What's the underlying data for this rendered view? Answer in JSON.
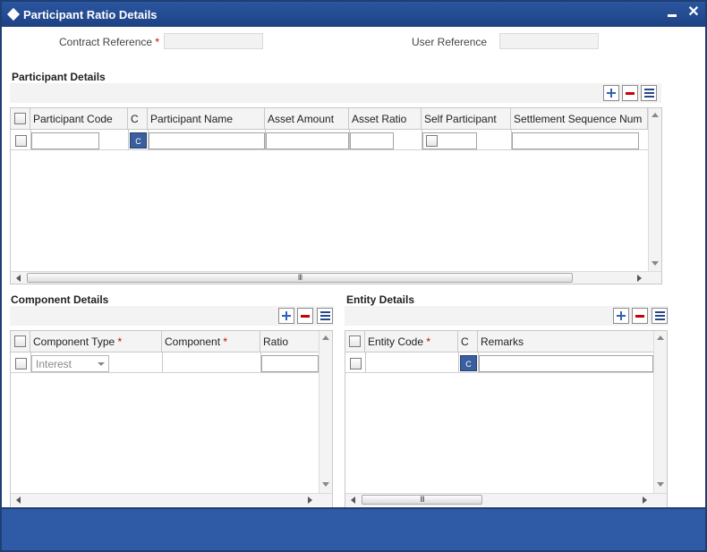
{
  "window": {
    "title": "Participant Ratio Details"
  },
  "header": {
    "contract_reference_label": "Contract Reference",
    "user_reference_label": "User Reference",
    "required_mark": "*",
    "contract_reference_value": "",
    "user_reference_value": ""
  },
  "participant": {
    "title": "Participant Details",
    "columns": [
      "Participant Code",
      "C",
      "Participant Name",
      "Asset Amount",
      "Asset Ratio",
      "Self Participant",
      "Settlement Sequence Num"
    ],
    "row_badge": "C"
  },
  "component": {
    "title": "Component Details",
    "columns": {
      "component_type": "Component Type",
      "component": "Component",
      "ratio": "Ratio"
    },
    "required_mark": "*",
    "row": {
      "component_type": "Interest"
    }
  },
  "entity": {
    "title": "Entity Details",
    "columns": {
      "entity_code": "Entity Code",
      "c": "C",
      "remarks": "Remarks"
    },
    "required_mark": "*",
    "row_badge": "C"
  },
  "icons": {
    "window": "diamond-icon",
    "minimize": "minimize-icon",
    "close": "close-icon",
    "add": "plus-icon",
    "delete": "minus-icon",
    "view": "list-icon"
  },
  "colors": {
    "titlebar": "#1d4283",
    "footer": "#2f5aa5",
    "required": "#cc0000",
    "badge": "#3a5f9f"
  }
}
